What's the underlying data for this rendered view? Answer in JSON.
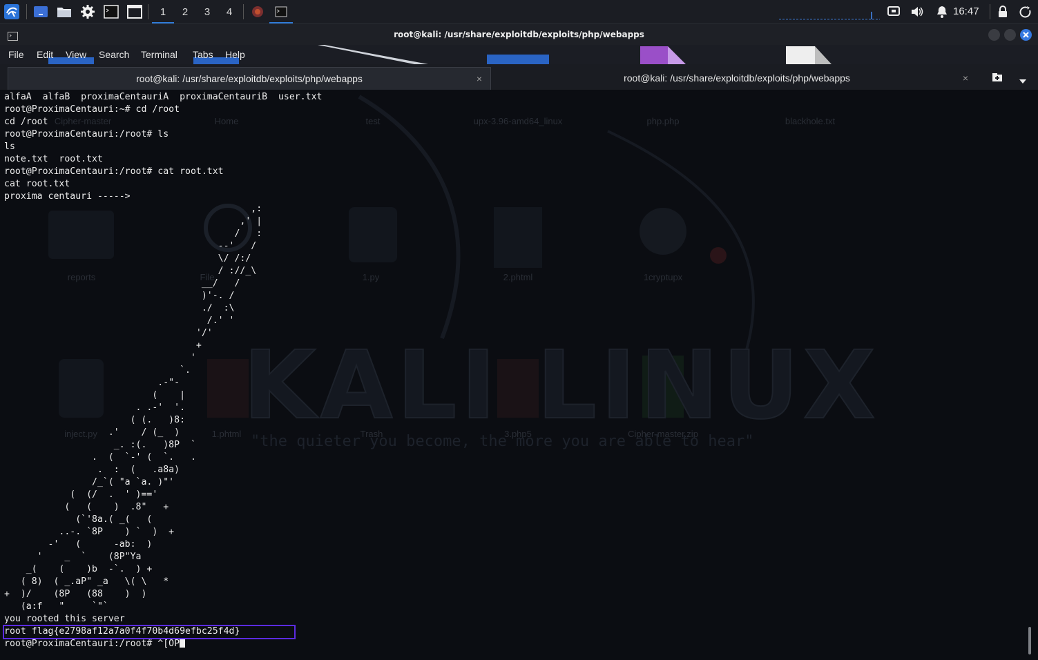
{
  "panel": {
    "workspaces": [
      "1",
      "2",
      "3",
      "4"
    ],
    "active_workspace": "1",
    "clock": "16:47",
    "icons": [
      "kali-menu-icon",
      "desktop-icon",
      "files-icon",
      "settings-icon",
      "terminal-icon",
      "window-icon",
      "firefox-icon",
      "terminal-task-icon",
      "network-icon",
      "volume-icon",
      "bell-icon",
      "lock-icon",
      "power-icon"
    ]
  },
  "window": {
    "title": "root@kali: /usr/share/exploitdb/exploits/php/webapps"
  },
  "menubar": [
    "File",
    "Edit",
    "View",
    "Search",
    "Terminal",
    "Tabs",
    "Help"
  ],
  "tabs": [
    {
      "label": "root@kali: /usr/share/exploitdb/exploits/php/webapps",
      "close": "×"
    },
    {
      "label": "root@kali: /usr/share/exploitdb/exploits/php/webapps",
      "close": "×"
    }
  ],
  "wallpaper": {
    "desktop_icons": [
      "Cipher-master",
      "Home",
      "test",
      "upx-3.96-amd64_linux",
      "php.php",
      "blackhole.txt",
      "reports",
      "File",
      "1.py",
      "2.phtml",
      "1cryptupx",
      "inject.py",
      "1.phtml",
      "Trash",
      "3.php5",
      "Cipher-master.zip"
    ],
    "logo": "KALI LINUX",
    "quote": "\"the quieter you become, the more you are able to hear\""
  },
  "terminal": {
    "lines": [
      "alfaA  alfaB  proximaCentauriA  proximaCentauriB  user.txt",
      "root@ProximaCentauri:~# cd /root",
      "cd /root",
      "root@ProximaCentauri:/root# ls",
      "ls",
      "note.txt  root.txt",
      "root@ProximaCentauri:/root# cat root.txt",
      "cat root.txt",
      "proxima centauri ----->",
      "                                             ,:",
      "                                           ,' |",
      "                                          /   :",
      "                                       --'   /",
      "                                       \\/ /:/",
      "                                       / ://_\\",
      "                                    __/   /",
      "                                    )'-. /",
      "                                    ./  :\\",
      "                                     /.' '",
      "                                   '/'",
      "                                   +",
      "                                  '",
      "                                `.",
      "                            .-\"-",
      "                           (    |",
      "                        . .-'  '.",
      "                       ( (.   )8:",
      "                   .'    / (_  )",
      "                    _. :(.   )8P  `",
      "                .  (  `-' (  `.   .",
      "                 .  :  (   .a8a)",
      "                /_`( \"a `a. )\"'",
      "            (  (/  .  ' )=='",
      "           (   (    )  .8\"   +",
      "             (`'8a.( _(   (",
      "          ..-. `8P    ) `  )  +",
      "        -'   (      -ab:  )",
      "      '    _  `    (8P\"Ya",
      "    _(    (    )b  -`.  ) +",
      "   ( 8)  ( _.aP\" _a   \\( \\   *",
      "+  )/    (8P   (88    )  )",
      "   (a:f   \"     `\"`",
      "you rooted this server",
      "root flag{e2798af12a7a0f4f70b4d69efbc25f4d}",
      "root@ProximaCentauri:/root# ^[OP"
    ]
  }
}
